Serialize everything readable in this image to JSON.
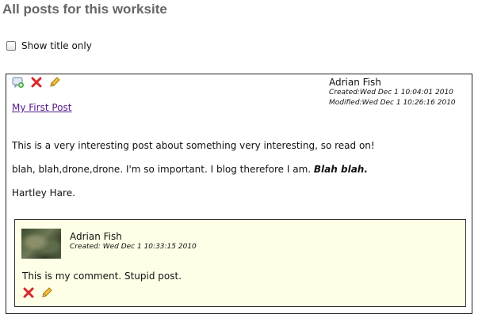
{
  "page": {
    "heading": "All posts for this worksite"
  },
  "filter": {
    "show_title_only_label": "Show title only",
    "show_title_only_checked": false
  },
  "post": {
    "actions": {
      "comment_icon": "add-comment-icon",
      "delete_icon": "delete-x-icon",
      "edit_icon": "edit-pencil-icon"
    },
    "author": "Adrian Fish",
    "created": "Created:Wed Dec 1 10:04:01 2010",
    "modified": "Modified:Wed Dec 1 10:26:16 2010",
    "title": "My First Post",
    "paragraph1": "This is a very interesting post about something very interesting, so read on!",
    "paragraph2_plain": "blah, blah,drone,drone. I'm so important. I blog therefore I am.",
    "paragraph2_emph": "Blah blah.",
    "paragraph3": "Hartley Hare."
  },
  "comment": {
    "author": "Adrian Fish",
    "created": "Created: Wed Dec 1 10:33:15 2010",
    "text": "This is my comment. Stupid post.",
    "actions": {
      "delete_icon": "delete-x-icon",
      "edit_icon": "edit-pencil-icon"
    }
  },
  "colors": {
    "comment_background": "#fffee6",
    "link": "#551a8b",
    "heading": "#666666"
  }
}
